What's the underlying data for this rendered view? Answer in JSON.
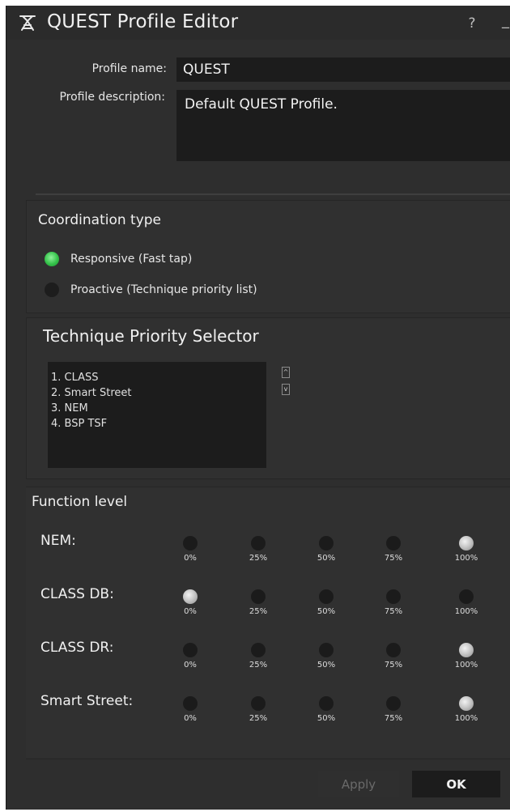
{
  "window": {
    "title": "QUEST Profile Editor",
    "help_label": "?",
    "minimize_label": "_"
  },
  "profile": {
    "name_label": "Profile name:",
    "name_value": "QUEST",
    "description_label": "Profile description:",
    "description_value": "Default QUEST Profile."
  },
  "coordination": {
    "title": "Coordination type",
    "options": [
      {
        "label": "Responsive (Fast tap)",
        "selected": true
      },
      {
        "label": "Proactive (Technique priority list)",
        "selected": false
      }
    ]
  },
  "technique_priority": {
    "title": "Technique Priority Selector",
    "items": [
      "1. CLASS",
      "2. Smart Street",
      "3. NEM",
      "4. BSP TSF"
    ],
    "up_label": "^",
    "down_label": "v"
  },
  "function_level": {
    "title": "Function level",
    "levels": [
      "0%",
      "25%",
      "50%",
      "75%",
      "100%"
    ],
    "rows": [
      {
        "label": "NEM:",
        "selected": "100%"
      },
      {
        "label": "CLASS DB:",
        "selected": "0%"
      },
      {
        "label": "CLASS DR:",
        "selected": "100%"
      },
      {
        "label": "Smart Street:",
        "selected": "100%"
      }
    ]
  },
  "buttons": {
    "apply": "Apply",
    "ok": "OK"
  },
  "colors": {
    "background": "#2e2e2e",
    "field": "#1c1c1c",
    "radio_selected": "#34c24a",
    "level_selected": "#c8c8c8"
  }
}
